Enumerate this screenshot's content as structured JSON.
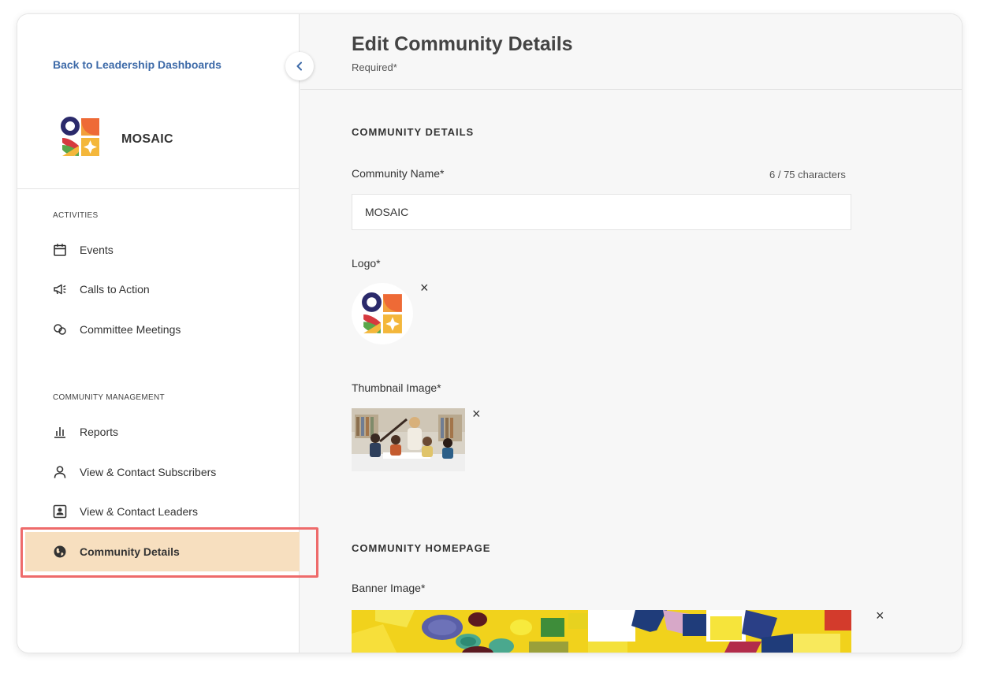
{
  "sidebar": {
    "back_link": "Back to Leadership Dashboards",
    "brand_name": "MOSAIC",
    "sections": {
      "activities": "ACTIVITIES",
      "management": "COMMUNITY MANAGEMENT"
    },
    "items": {
      "events": "Events",
      "calls": "Calls to Action",
      "committee": "Committee Meetings",
      "reports": "Reports",
      "subscribers": "View & Contact Subscribers",
      "leaders": "View & Contact Leaders",
      "details": "Community Details"
    }
  },
  "main": {
    "title": "Edit Community Details",
    "required_note": "Required*",
    "community_details_heading": "COMMUNITY DETAILS",
    "name_label": "Community Name*",
    "char_count": "6 / 75 characters",
    "name_value": "MOSAIC",
    "logo_label": "Logo*",
    "thumbnail_label": "Thumbnail Image*",
    "homepage_heading": "COMMUNITY HOMEPAGE",
    "banner_label": "Banner Image*",
    "remove_glyph": "×"
  },
  "colors": {
    "link": "#3d6aa8",
    "active_bg": "#f7dfbf",
    "highlight_outline": "#ee6b6b"
  }
}
